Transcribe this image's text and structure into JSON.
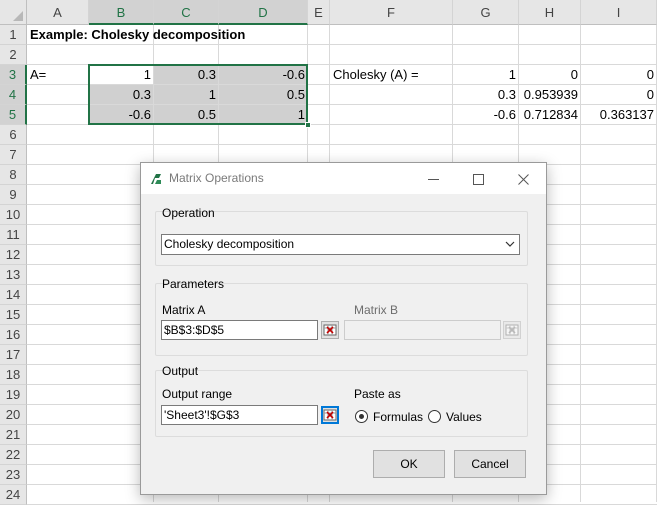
{
  "sheet": {
    "columns": [
      "A",
      "B",
      "C",
      "D",
      "E",
      "F",
      "G",
      "H",
      "I"
    ],
    "selected_columns": [
      "B",
      "C",
      "D"
    ],
    "rows": [
      "1",
      "2",
      "3",
      "4",
      "5",
      "6",
      "7",
      "8",
      "9",
      "10",
      "11",
      "12",
      "13",
      "14",
      "15",
      "16",
      "17",
      "18",
      "19",
      "20",
      "21",
      "22",
      "23",
      "24"
    ],
    "selected_rows": [
      "3",
      "4",
      "5"
    ],
    "title": "Example: Cholesky decomposition",
    "a_label": "A=",
    "chol_label": "Cholesky (A) =",
    "matrix_a": [
      [
        "1",
        "0.3",
        "-0.6"
      ],
      [
        "0.3",
        "1",
        "0.5"
      ],
      [
        "-0.6",
        "0.5",
        "1"
      ]
    ],
    "chol_result": [
      [
        "1",
        "0",
        "0"
      ],
      [
        "0.3",
        "0.953939",
        "0"
      ],
      [
        "-0.6",
        "0.712834",
        "0.363137"
      ]
    ],
    "accent_color": "#217346"
  },
  "dialog": {
    "title": "Matrix Operations",
    "operation_group": "Operation",
    "operation_value": "Cholesky decomposition",
    "parameters_group": "Parameters",
    "matrix_a_label": "Matrix A",
    "matrix_a_value": "$B$3:$D$5",
    "matrix_b_label": "Matrix B",
    "matrix_b_value": "",
    "output_group": "Output",
    "output_range_label": "Output range",
    "output_range_value": "'Sheet3'!$G$3",
    "paste_as_label": "Paste as",
    "paste_options": [
      "Formulas",
      "Values"
    ],
    "paste_selected": "Formulas",
    "ok_label": "OK",
    "cancel_label": "Cancel"
  }
}
